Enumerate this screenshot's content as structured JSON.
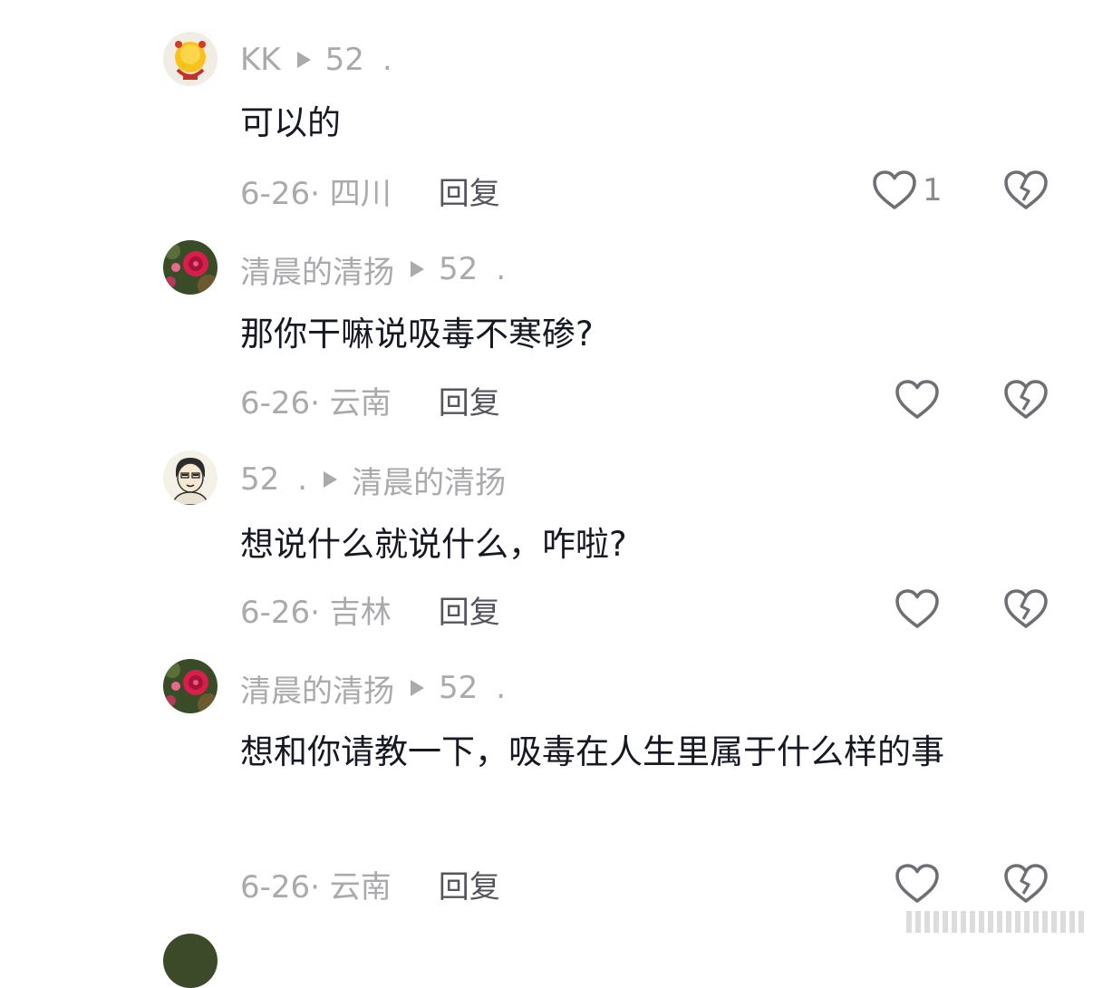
{
  "comments": [
    {
      "author": "KK",
      "reply_to": "52",
      "reply_to_suffix": ".",
      "text": "可以的",
      "date_location": "6-26· 四川",
      "reply_label": "回复",
      "like_count": "1",
      "avatar": "yellow-smiley-avatar"
    },
    {
      "author": "清晨的清扬",
      "reply_to": "52",
      "reply_to_suffix": ".",
      "text": "那你干嘛说吸毒不寒碜?",
      "date_location": "6-26· 云南",
      "reply_label": "回复",
      "like_count": "",
      "avatar": "red-flower-avatar"
    },
    {
      "author": "52",
      "author_suffix": ".",
      "reply_to": "清晨的清扬",
      "text": "想说什么就说什么，咋啦?",
      "date_location": "6-26· 吉林",
      "reply_label": "回复",
      "like_count": "",
      "avatar": "cartoon-man-avatar"
    },
    {
      "author": "清晨的清扬",
      "reply_to": "52",
      "reply_to_suffix": ".",
      "text": "想和你请教一下，吸毒在人生里属于什么样的事",
      "date_location": "6-26· 云南",
      "reply_label": "回复",
      "like_count": "",
      "avatar": "red-flower-avatar"
    }
  ],
  "icons": {
    "like": "heart-outline-icon",
    "dislike": "broken-heart-icon",
    "reply_arrow": "play-triangle-icon"
  },
  "colors": {
    "text": "#161823",
    "meta": "#a9a9ae",
    "reply": "#55565d",
    "icon": "#6e6f75"
  }
}
